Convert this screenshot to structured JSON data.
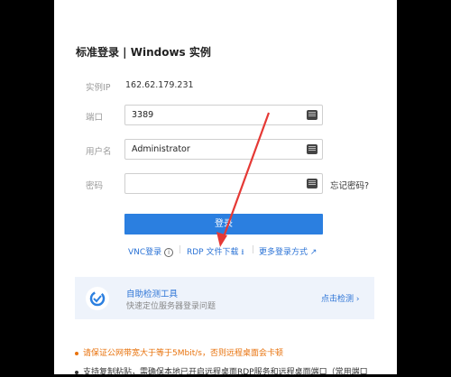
{
  "header": {
    "title": "标准登录 | Windows 实例"
  },
  "form": {
    "instance_ip_label": "实例IP",
    "instance_ip_value": "162.62.179.231",
    "port_label": "端口",
    "port_value": "3389",
    "username_label": "用户名",
    "username_value": "Administrator",
    "password_label": "密码",
    "password_value": "",
    "forgot_password": "忘记密码?",
    "login_button": "登录"
  },
  "links": {
    "vnc_login": "VNC登录",
    "rdp_download": "RDP 文件下载",
    "more_methods": "更多登录方式"
  },
  "tool": {
    "title": "自助检测工具",
    "desc": "快速定位服务器登录问题",
    "action": "点击检测"
  },
  "tips": {
    "tip1": "请保证公网带宽大于等于5Mbit/s，否则远程桌面会卡顿",
    "tip2": "支持复制粘贴，需确保本地已开启远程桌面RDP服务和远程桌面端口（常用端口"
  },
  "colors": {
    "accent": "#2b7fe0",
    "warning": "#e8720c",
    "annotation_arrow": "#e53935"
  },
  "icons": {
    "keyboard": "keyboard-icon",
    "info": "info-icon",
    "download": "download-icon",
    "external": "external-link-icon",
    "chevron": "chevron-right-icon",
    "tool": "diagnose-tool-icon"
  }
}
